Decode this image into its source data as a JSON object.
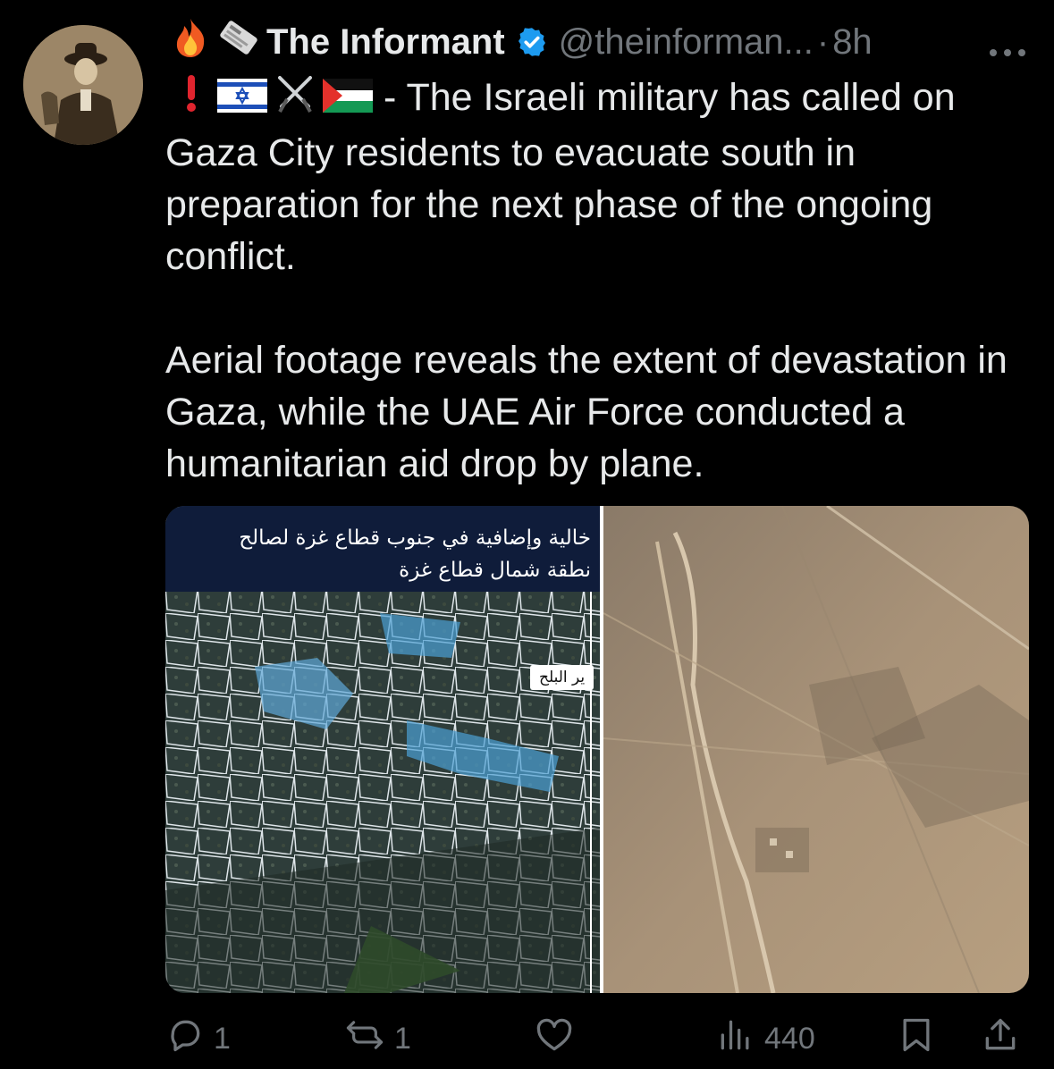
{
  "tweet": {
    "author": {
      "display_name": "The Informant",
      "handle": "@theinforman...",
      "separator": "·",
      "time": "8h",
      "verified": true,
      "header_icons": [
        "fire-icon",
        "newspaper-icon"
      ]
    },
    "lead_icons": [
      "exclamation-icon",
      "israel-flag-icon",
      "crossed-swords-icon",
      "palestine-flag-icon"
    ],
    "paragraphs": [
      "- The Israeli military has called on Gaza City residents to evacuate south in preparation for the next phase of the ongoing conflict.",
      "Aerial footage reveals the extent of devastation in Gaza, while the UAE Air Force conducted a humanitarian aid drop by plane."
    ],
    "media": {
      "map": {
        "banner_lines": [
          "خالية وإضافية في جنوب قطاع غزة لصالح",
          "نطقة شمال قطاع غزة"
        ],
        "place_label": "ير البلح"
      }
    },
    "actions": {
      "replies": "1",
      "reposts": "1",
      "likes": "",
      "views": "440"
    }
  },
  "colors": {
    "background": "#000000",
    "text": "#e7e9ea",
    "muted": "#71767b",
    "verified": "#1d9bf0"
  }
}
